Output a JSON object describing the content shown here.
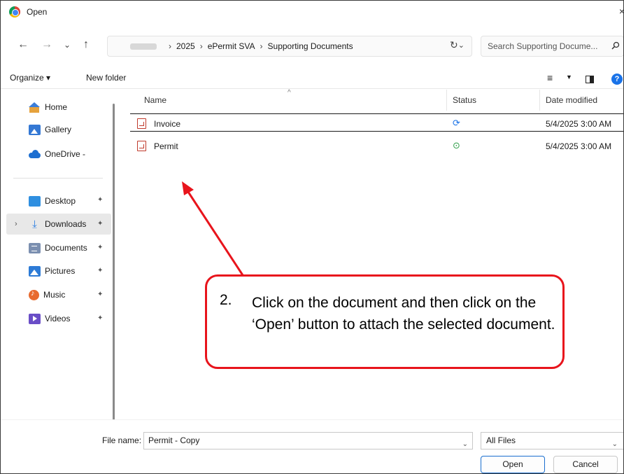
{
  "window": {
    "title": "Open",
    "close_glyph": "×"
  },
  "nav": {
    "back": "←",
    "forward": "→",
    "history": "⌄",
    "up": "↑",
    "refresh": "↻"
  },
  "breadcrumb": {
    "items": [
      "2025",
      "ePermit SVA",
      "Supporting Documents"
    ],
    "separator": "›",
    "dropdown": "⌄"
  },
  "search": {
    "placeholder": "Search Supporting Docume...",
    "icon": "search-icon"
  },
  "toolbar": {
    "organize_label": "Organize ▾",
    "new_folder_label": "New folder",
    "view_glyph": "≡",
    "view_dd": "▼",
    "help_glyph": "?"
  },
  "sidebar": {
    "items": [
      {
        "label": "Home",
        "icon": "home-icon"
      },
      {
        "label": "Gallery",
        "icon": "gallery-icon"
      },
      {
        "label": "OneDrive -",
        "icon": "onedrive-icon"
      }
    ],
    "quick_access": [
      {
        "label": "Desktop",
        "icon": "desktop-icon"
      },
      {
        "label": "Downloads",
        "icon": "downloads-icon"
      },
      {
        "label": "Documents",
        "icon": "documents-icon"
      },
      {
        "label": "Pictures",
        "icon": "pictures-icon"
      },
      {
        "label": "Music",
        "icon": "music-icon"
      },
      {
        "label": "Videos",
        "icon": "videos-icon"
      }
    ],
    "pin_glyph": "📌",
    "expander_glyph": "›"
  },
  "filelist": {
    "columns": {
      "name": "Name",
      "status": "Status",
      "date": "Date modified"
    },
    "sort_glyph": "^",
    "rows": [
      {
        "name": "Invoice",
        "status_glyph": "⟳",
        "status_color": "#1a73e8",
        "date": "5/4/2025 3:00 AM"
      },
      {
        "name": "Permit",
        "status_glyph": "⊙",
        "status_color": "#2e9e48",
        "date": "5/4/2025 3:00 AM"
      }
    ]
  },
  "annotation": {
    "number": "2.",
    "text": "Click on the document and then click on the ‘Open’ button to attach the selected document.",
    "color": "#e8141c"
  },
  "footer": {
    "file_name_label": "File name:",
    "file_name_value": "Permit - Copy",
    "filter_value": "All Files",
    "dropdown_glyph": "⌄",
    "open_label": "Open",
    "cancel_label": "Cancel"
  }
}
